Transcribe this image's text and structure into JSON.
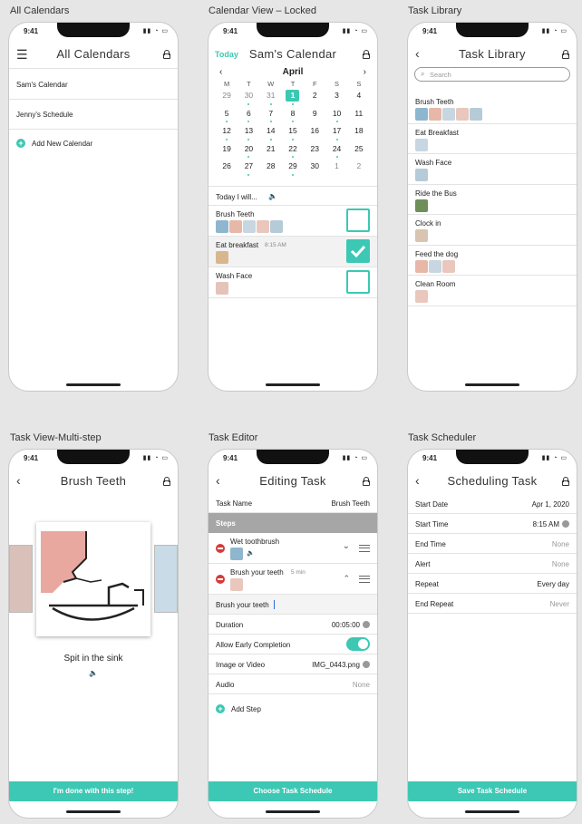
{
  "frames": {
    "all": {
      "label": "All Calendars",
      "title": "All Calendars",
      "items": [
        "Sam's Calendar",
        "Jenny's Schedule"
      ],
      "add": "Add New Calendar"
    },
    "calview": {
      "label": "Calendar View – Locked",
      "today": "Today",
      "title": "Sam's Calendar",
      "month": "April",
      "dow": [
        "M",
        "T",
        "W",
        "T",
        "F",
        "S",
        "S"
      ],
      "weeks": [
        [
          "29",
          "30",
          "31",
          "1",
          "2",
          "3",
          "4"
        ],
        [
          "5",
          "6",
          "7",
          "8",
          "9",
          "10",
          "11"
        ],
        [
          "12",
          "13",
          "14",
          "15",
          "16",
          "17",
          "18"
        ],
        [
          "19",
          "20",
          "21",
          "22",
          "23",
          "24",
          "25"
        ],
        [
          "26",
          "27",
          "28",
          "29",
          "30",
          "1",
          "2"
        ]
      ],
      "today_label": "Today I will...",
      "tasks": [
        {
          "name": "Brush Teeth",
          "time": ""
        },
        {
          "name": "Eat breakfast",
          "time": "8:15 AM"
        },
        {
          "name": "Wash Face",
          "time": ""
        }
      ]
    },
    "library": {
      "label": "Task Library",
      "title": "Task Library",
      "search_placeholder": "Search",
      "tasks": [
        "Brush Teeth",
        "Eat Breakfast",
        "Wash Face",
        "Ride the Bus",
        "Clock in",
        "Feed the dog",
        "Clean Room"
      ]
    },
    "taskview": {
      "label": "Task View-Multi-step",
      "title": "Brush Teeth",
      "caption": "Spit in the sink",
      "button": "I'm done with this step!"
    },
    "editor": {
      "label": "Task Editor",
      "title": "Editing Task",
      "task_name_label": "Task Name",
      "task_name_value": "Brush Teeth",
      "steps_header": "Steps",
      "step1": "Wet toothbrush",
      "step2": "Brush your teeth",
      "step2_duration": "5 min",
      "step_text": "Brush your teeth",
      "rows": [
        {
          "label": "Duration",
          "value": "00:05:00"
        },
        {
          "label": "Allow Early Completion",
          "value": ""
        },
        {
          "label": "Image or Video",
          "value": "IMG_0443.png"
        },
        {
          "label": "Audio",
          "value": "None"
        }
      ],
      "add_step": "Add Step",
      "button": "Choose Task Schedule"
    },
    "scheduler": {
      "label": "Task Scheduler",
      "title": "Scheduling Task",
      "rows": [
        {
          "label": "Start Date",
          "value": "Apr 1, 2020"
        },
        {
          "label": "Start Time",
          "value": "8:15 AM"
        },
        {
          "label": "End Time",
          "value": "None"
        },
        {
          "label": "Alert",
          "value": "None"
        },
        {
          "label": "Repeat",
          "value": "Every day"
        },
        {
          "label": "End Repeat",
          "value": "Never"
        }
      ],
      "button": "Save Task Schedule"
    }
  },
  "status_time": "9:41",
  "colors": {
    "accent": "#3cc8b4",
    "delete": "#d43b3b"
  }
}
